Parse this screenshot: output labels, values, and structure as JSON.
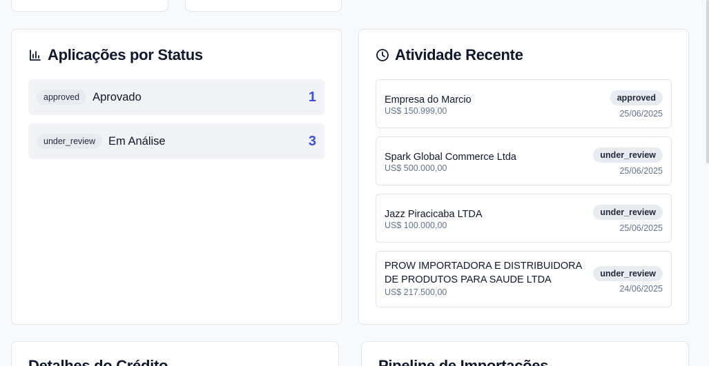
{
  "status_section": {
    "title": "Aplicações por Status",
    "icon": "bar-chart-icon",
    "rows": [
      {
        "badge": "approved",
        "label": "Aprovado",
        "count": "1"
      },
      {
        "badge": "under_review",
        "label": "Em Análise",
        "count": "3"
      }
    ]
  },
  "activity_section": {
    "title": "Atividade Recente",
    "icon": "clock-icon",
    "items": [
      {
        "name": "Empresa do Marcio",
        "amount": "US$ 150.999,00",
        "status": "approved",
        "date": "25/06/2025"
      },
      {
        "name": "Spark Global Commerce Ltda",
        "amount": "US$ 500.000,00",
        "status": "under_review",
        "date": "25/06/2025"
      },
      {
        "name": "Jazz Piracicaba LTDA",
        "amount": "US$ 100.000,00",
        "status": "under_review",
        "date": "25/06/2025"
      },
      {
        "name": "PROW IMPORTADORA E DISTRIBUIDORA DE PRODUTOS PARA SAUDE LTDA",
        "amount": "US$ 217.500,00",
        "status": "under_review",
        "date": "24/06/2025"
      }
    ]
  },
  "bottom": {
    "credit_title": "Detalhes do Crédito",
    "pipeline_title": "Pipeline de Importações"
  },
  "colors": {
    "accent": "#3d4ed8",
    "badge_bg": "#e8ebf0",
    "page_bg": "#f8f9fb"
  }
}
